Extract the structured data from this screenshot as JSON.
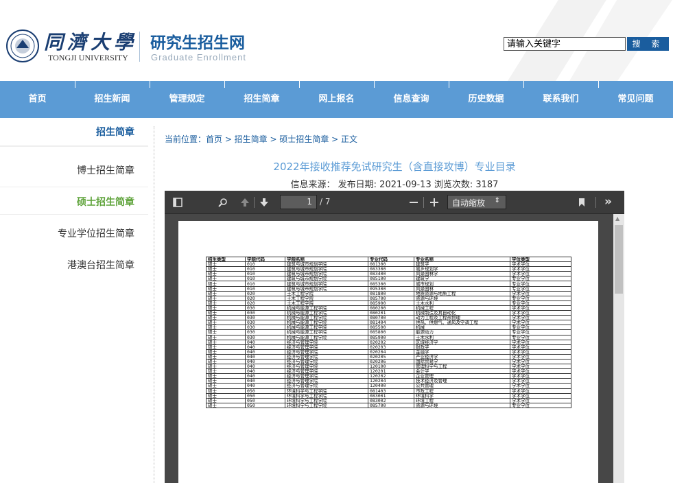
{
  "header": {
    "university_cn": "同濟大學",
    "university_en": "TONGJI UNIVERSITY",
    "site_cn": "研究生招生网",
    "site_en": "Graduate Enrollment",
    "search_placeholder": "请输入关键字",
    "search_button": "搜 索"
  },
  "nav": [
    "首页",
    "招生新闻",
    "管理规定",
    "招生简章",
    "网上报名",
    "信息查询",
    "历史数据",
    "联系我们",
    "常见问题"
  ],
  "sidebar": {
    "title": "招生简章",
    "items": [
      "博士招生简章",
      "硕士招生简章",
      "专业学位招生简章",
      "港澳台招生简章"
    ]
  },
  "breadcrumb": "当前位置：首页 > 招生简章 > 硕士招生简章 > 正文",
  "article": {
    "title": "2022年接收推荐免试研究生（含直接攻博）专业目录",
    "meta": "信息来源：  发布日期: 2021-09-13 浏览次数: 3187"
  },
  "viewer": {
    "page_current": "1",
    "page_total": "/ 7",
    "zoom": "自动缩放"
  },
  "pdf_table": {
    "headers": [
      "招生类型",
      "学院代码",
      "学院名称",
      "专业代码",
      "专业名称",
      "学位类型"
    ],
    "rows": [
      [
        "硕士",
        "010",
        "建筑与城市规划学院",
        "081300",
        "建筑学",
        "学术学位"
      ],
      [
        "硕士",
        "010",
        "建筑与城市规划学院",
        "083300",
        "城乡规划学",
        "学术学位"
      ],
      [
        "硕士",
        "010",
        "建筑与城市规划学院",
        "083400",
        "风景园林学",
        "学术学位"
      ],
      [
        "硕士",
        "010",
        "建筑与城市规划学院",
        "085100",
        "建筑学",
        "专业学位"
      ],
      [
        "硕士",
        "010",
        "建筑与城市规划学院",
        "085300",
        "城市规划",
        "专业学位"
      ],
      [
        "硕士",
        "010",
        "建筑与城市规划学院",
        "095300",
        "风景园林",
        "专业学位"
      ],
      [
        "硕士",
        "020",
        "土木工程学院",
        "081800",
        "地质资源与地质工程",
        "学术学位"
      ],
      [
        "硕士",
        "020",
        "土木工程学院",
        "085700",
        "资源与环境",
        "专业学位"
      ],
      [
        "硕士",
        "020",
        "土木工程学院",
        "085900",
        "土木水利",
        "专业学位"
      ],
      [
        "硕士",
        "030",
        "机械与能源工程学院",
        "080200",
        "机械工程",
        "学术学位"
      ],
      [
        "硕士",
        "030",
        "机械与能源工程学院",
        "080201",
        "机械制造及其自动化",
        "学术学位"
      ],
      [
        "硕士",
        "030",
        "机械与能源工程学院",
        "080700",
        "动力工程及工程热物理",
        "学术学位"
      ],
      [
        "硕士",
        "030",
        "机械与能源工程学院",
        "081404",
        "供热、供燃气、通风及空调工程",
        "学术学位"
      ],
      [
        "硕士",
        "030",
        "机械与能源工程学院",
        "085500",
        "机械",
        "专业学位"
      ],
      [
        "硕士",
        "030",
        "机械与能源工程学院",
        "085800",
        "能源动力",
        "专业学位"
      ],
      [
        "硕士",
        "030",
        "机械与能源工程学院",
        "085900",
        "土木水利",
        "专业学位"
      ],
      [
        "硕士",
        "040",
        "经济与管理学院",
        "020202",
        "区域经济学",
        "学术学位"
      ],
      [
        "硕士",
        "040",
        "经济与管理学院",
        "020203",
        "财政学",
        "学术学位"
      ],
      [
        "硕士",
        "040",
        "经济与管理学院",
        "020204",
        "金融学",
        "学术学位"
      ],
      [
        "硕士",
        "040",
        "经济与管理学院",
        "020205",
        "产业经济学",
        "学术学位"
      ],
      [
        "硕士",
        "040",
        "经济与管理学院",
        "020206",
        "国际贸易学",
        "学术学位"
      ],
      [
        "硕士",
        "040",
        "经济与管理学院",
        "120100",
        "管理科学与工程",
        "学术学位"
      ],
      [
        "硕士",
        "040",
        "经济与管理学院",
        "120201",
        "会计学",
        "学术学位"
      ],
      [
        "硕士",
        "040",
        "经济与管理学院",
        "120202",
        "企业管理",
        "学术学位"
      ],
      [
        "硕士",
        "040",
        "经济与管理学院",
        "120204",
        "技术经济及管理",
        "学术学位"
      ],
      [
        "硕士",
        "040",
        "经济与管理学院",
        "120400",
        "公共管理",
        "学术学位"
      ],
      [
        "硕士",
        "050",
        "环境科学与工程学院",
        "081403",
        "市政工程",
        "学术学位"
      ],
      [
        "硕士",
        "050",
        "环境科学与工程学院",
        "083001",
        "环境科学",
        "学术学位"
      ],
      [
        "硕士",
        "050",
        "环境科学与工程学院",
        "083002",
        "环境工程",
        "学术学位"
      ],
      [
        "硕士",
        "050",
        "环境科学与工程学院",
        "085700",
        "资源与环境",
        "专业学位"
      ]
    ]
  }
}
